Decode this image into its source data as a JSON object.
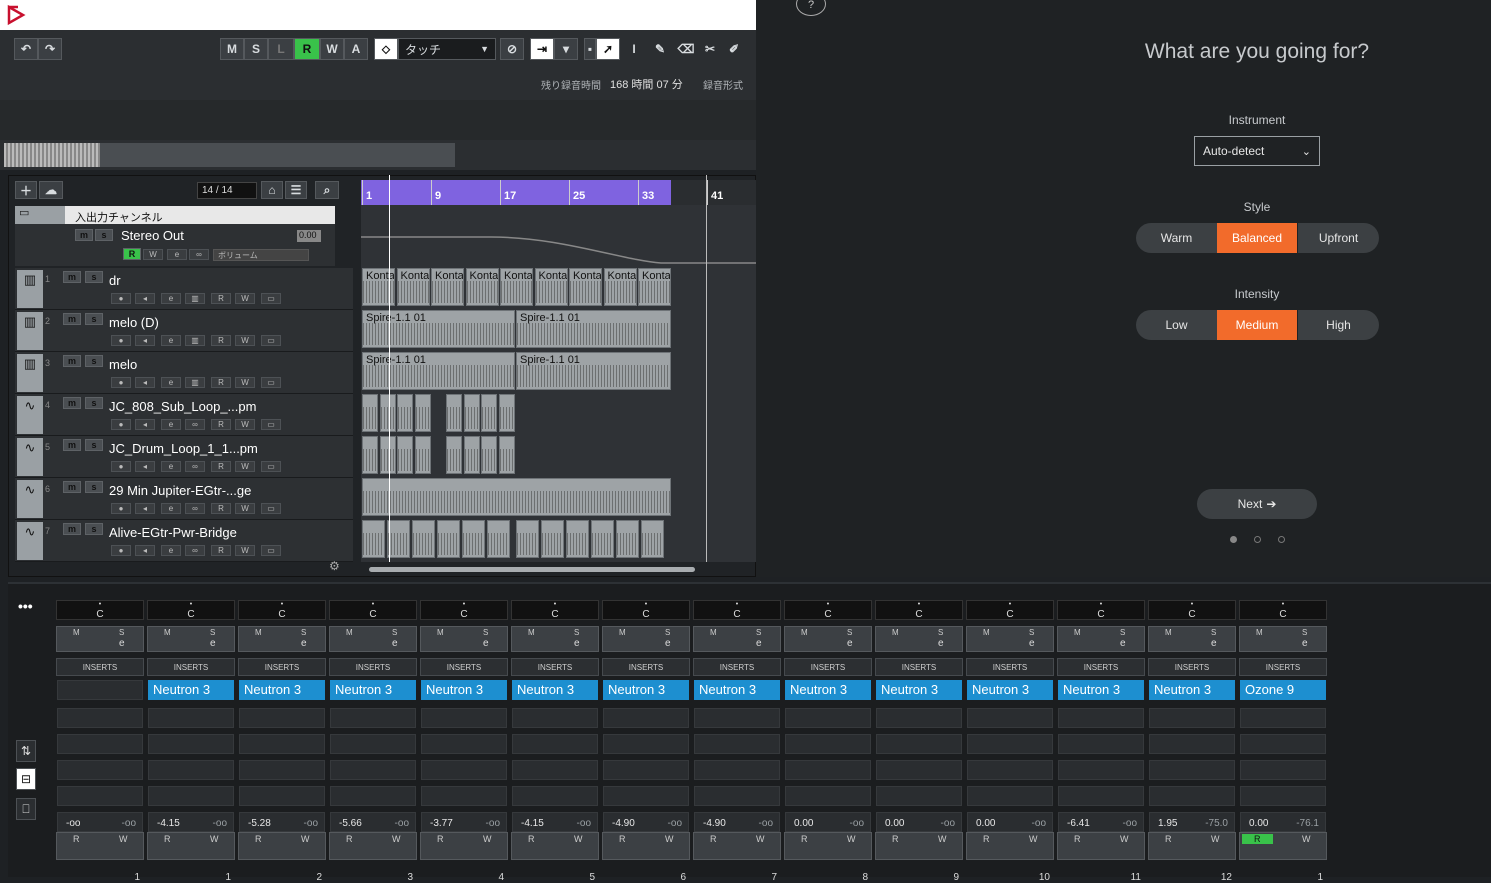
{
  "toolbar": {
    "m": "M",
    "s": "S",
    "l": "L",
    "r": "R",
    "w": "W",
    "a": "A",
    "automation_mode": "タッチ",
    "remaining_label": "残り録音時間",
    "remaining_value": "168 時間 07 分",
    "record_format": "録音形式"
  },
  "tracklist": {
    "count": "14 / 14",
    "folder_name": "入出力チャンネル",
    "stereo_out": "Stereo Out",
    "stereo_out_level": "0.00",
    "volume_label": "ボリューム",
    "tracks": [
      {
        "num": "1",
        "name": "dr",
        "type": "instrument"
      },
      {
        "num": "2",
        "name": "melo (D)",
        "type": "instrument"
      },
      {
        "num": "3",
        "name": "melo",
        "type": "instrument"
      },
      {
        "num": "4",
        "name": "JC_808_Sub_Loop_...pm",
        "type": "audio"
      },
      {
        "num": "5",
        "name": "JC_Drum_Loop_1_1...pm",
        "type": "audio"
      },
      {
        "num": "6",
        "name": "29 Min Jupiter-EGtr-...ge",
        "type": "audio"
      },
      {
        "num": "7",
        "name": "Alive-EGtr-Pwr-Bridge",
        "type": "audio"
      }
    ]
  },
  "ruler": [
    "1",
    "9",
    "17",
    "25",
    "33",
    "41"
  ],
  "clips": {
    "konta": "Konta",
    "spire": "Spire-1.1 01"
  },
  "panel": {
    "help": "?",
    "heading": "What are you going for?",
    "instrument_label": "Instrument",
    "instrument_value": "Auto-detect",
    "style_label": "Style",
    "styles": [
      "Warm",
      "Balanced",
      "Upfront"
    ],
    "style_selected": "Balanced",
    "intensity_label": "Intensity",
    "intensities": [
      "Low",
      "Medium",
      "High"
    ],
    "intensity_selected": "Medium",
    "next": "Next",
    "accent": "#f26b2b"
  },
  "mixer": {
    "inserts_label": "INSERTS",
    "pan_label": "C",
    "strips": [
      {
        "plugin": "",
        "vol": "-oo",
        "peak": "-oo",
        "num": "1"
      },
      {
        "plugin": "Neutron 3",
        "vol": "-4.15",
        "peak": "-oo",
        "num": "1"
      },
      {
        "plugin": "Neutron 3",
        "vol": "-5.28",
        "peak": "-oo",
        "num": "2"
      },
      {
        "plugin": "Neutron 3",
        "vol": "-5.66",
        "peak": "-oo",
        "num": "3"
      },
      {
        "plugin": "Neutron 3",
        "vol": "-3.77",
        "peak": "-oo",
        "num": "4"
      },
      {
        "plugin": "Neutron 3",
        "vol": "-4.15",
        "peak": "-oo",
        "num": "5"
      },
      {
        "plugin": "Neutron 3",
        "vol": "-4.90",
        "peak": "-oo",
        "num": "6"
      },
      {
        "plugin": "Neutron 3",
        "vol": "-4.90",
        "peak": "-oo",
        "num": "7"
      },
      {
        "plugin": "Neutron 3",
        "vol": "0.00",
        "peak": "-oo",
        "num": "8"
      },
      {
        "plugin": "Neutron 3",
        "vol": "0.00",
        "peak": "-oo",
        "num": "9"
      },
      {
        "plugin": "Neutron 3",
        "vol": "0.00",
        "peak": "-oo",
        "num": "10"
      },
      {
        "plugin": "Neutron 3",
        "vol": "-6.41",
        "peak": "-oo",
        "num": "11"
      },
      {
        "plugin": "Neutron 3",
        "vol": "1.95",
        "peak": "-75.0",
        "num": "12"
      },
      {
        "plugin": "Ozone 9",
        "vol": "0.00",
        "peak": "-76.1",
        "num": "1"
      }
    ]
  }
}
